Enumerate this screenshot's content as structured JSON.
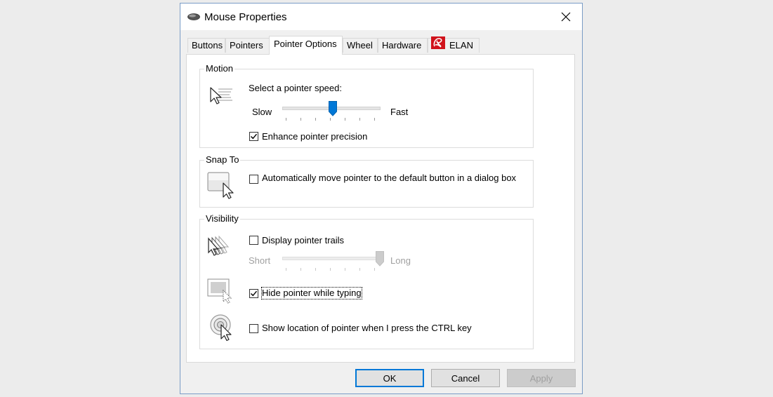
{
  "window": {
    "title": "Mouse Properties"
  },
  "tabs": [
    {
      "label": "Buttons",
      "active": false
    },
    {
      "label": "Pointers",
      "active": false
    },
    {
      "label": "Pointer Options",
      "active": true
    },
    {
      "label": "Wheel",
      "active": false
    },
    {
      "label": "Hardware",
      "active": false
    },
    {
      "label": "ELAN",
      "active": false,
      "icon": "elan-logo-icon"
    }
  ],
  "motion": {
    "group_label": "Motion",
    "speed_label": "Select a pointer speed:",
    "slow_label": "Slow",
    "fast_label": "Fast",
    "speed_value_fraction": 0.5,
    "enhance_label": "Enhance pointer precision",
    "enhance_checked": true
  },
  "snap_to": {
    "group_label": "Snap To",
    "auto_move_label": "Automatically move pointer to the default button in a dialog box",
    "auto_move_checked": false
  },
  "visibility": {
    "group_label": "Visibility",
    "trails_label": "Display pointer trails",
    "trails_checked": false,
    "short_label": "Short",
    "long_label": "Long",
    "trails_value_fraction": 1.0,
    "hide_label": "Hide pointer while typing",
    "hide_checked": true,
    "ctrl_label": "Show location of pointer when I press the CTRL key",
    "ctrl_checked": false
  },
  "buttons": {
    "ok": "OK",
    "cancel": "Cancel",
    "apply": "Apply"
  },
  "colors": {
    "accent": "#0078d7",
    "window_border": "#7a9cc6",
    "disabled_text": "#a0a0a0"
  }
}
